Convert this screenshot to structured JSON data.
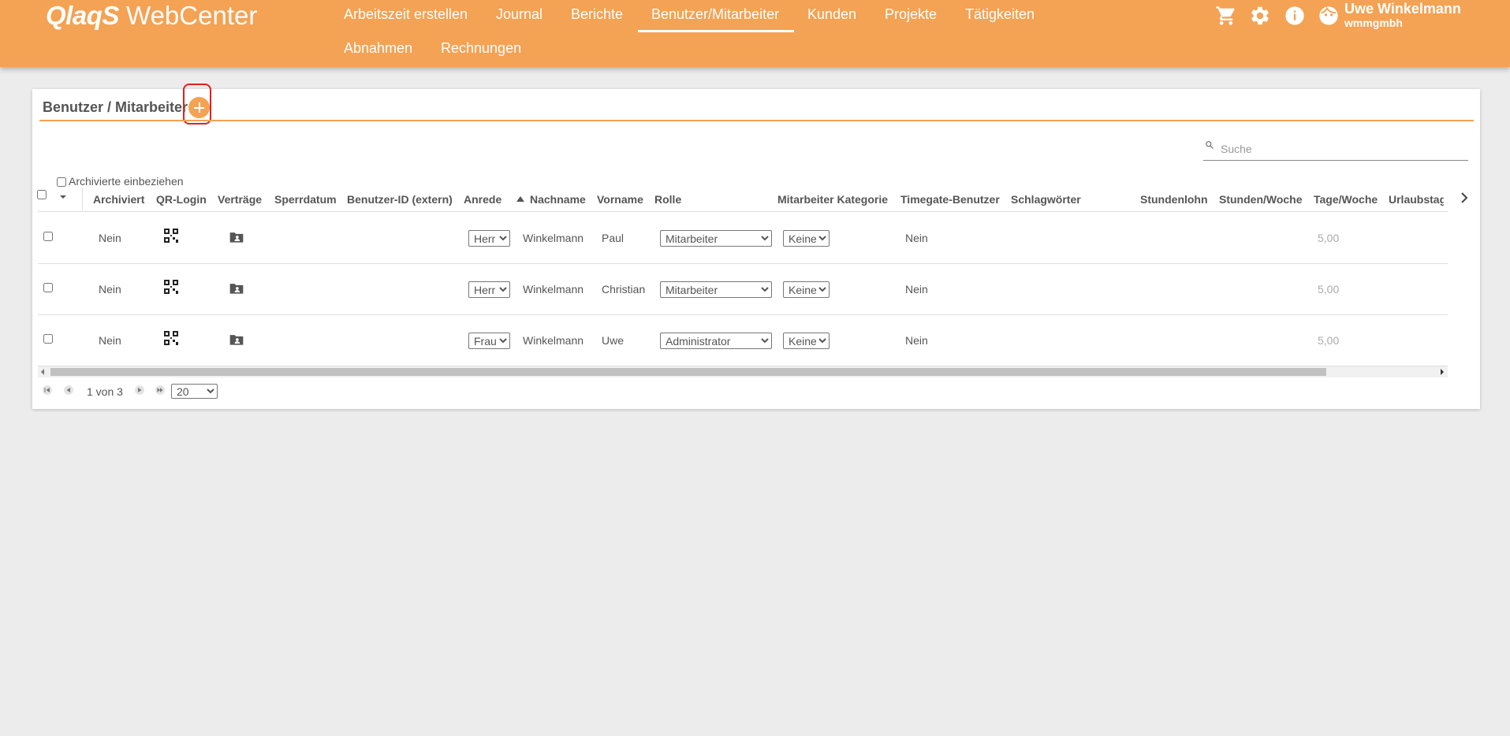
{
  "app": {
    "brand": "QlaqS",
    "product": "WebCenter"
  },
  "nav": {
    "items": [
      {
        "label": "Arbeitszeit erstellen"
      },
      {
        "label": "Journal"
      },
      {
        "label": "Berichte"
      },
      {
        "label": "Benutzer/Mitarbeiter",
        "active": true
      },
      {
        "label": "Kunden"
      },
      {
        "label": "Projekte"
      },
      {
        "label": "Tätigkeiten"
      },
      {
        "label": "Abnahmen"
      },
      {
        "label": "Rechnungen"
      }
    ]
  },
  "toolbar_icons": [
    "cart-icon",
    "gear-icon",
    "info-icon",
    "user-face-icon"
  ],
  "user": {
    "name": "Uwe Winkelmann",
    "company": "wmmgmbh"
  },
  "card": {
    "title": "Benutzer / Mitarbeiter",
    "search_placeholder": "Suche",
    "archived_label": "Archivierte einbeziehen"
  },
  "table": {
    "columns": [
      "Archiviert",
      "QR-Login",
      "Verträge",
      "Sperrdatum",
      "Benutzer-ID (extern)",
      "Anrede",
      "Nachname",
      "Vorname",
      "Rolle",
      "Mitarbeiter Kategorie",
      "Timegate-Benutzer",
      "Schlagwörter",
      "Stundenlohn",
      "Stunden/Woche",
      "Tage/Woche",
      "Urlaubstag"
    ],
    "sorted_column": "Nachname",
    "sort_direction": "ascending",
    "rows": [
      {
        "archiviert": "Nein",
        "anrede": "Herr",
        "nachname": "Winkelmann",
        "vorname": "Paul",
        "rolle": "Mitarbeiter",
        "kategorie": "Keine",
        "timegate": "Nein",
        "tage_woche": "5,00"
      },
      {
        "archiviert": "Nein",
        "anrede": "Herr",
        "nachname": "Winkelmann",
        "vorname": "Christian",
        "rolle": "Mitarbeiter",
        "kategorie": "Keine",
        "timegate": "Nein",
        "tage_woche": "5,00"
      },
      {
        "archiviert": "Nein",
        "anrede": "Frau",
        "nachname": "Winkelmann",
        "vorname": "Uwe",
        "rolle": "Administrator",
        "kategorie": "Keine",
        "timegate": "Nein",
        "tage_woche": "5,00"
      }
    ]
  },
  "pager": {
    "text": "1 von 3",
    "page_size": "20"
  },
  "colors": {
    "accent": "#f4a253",
    "highlight": "#e02020"
  }
}
